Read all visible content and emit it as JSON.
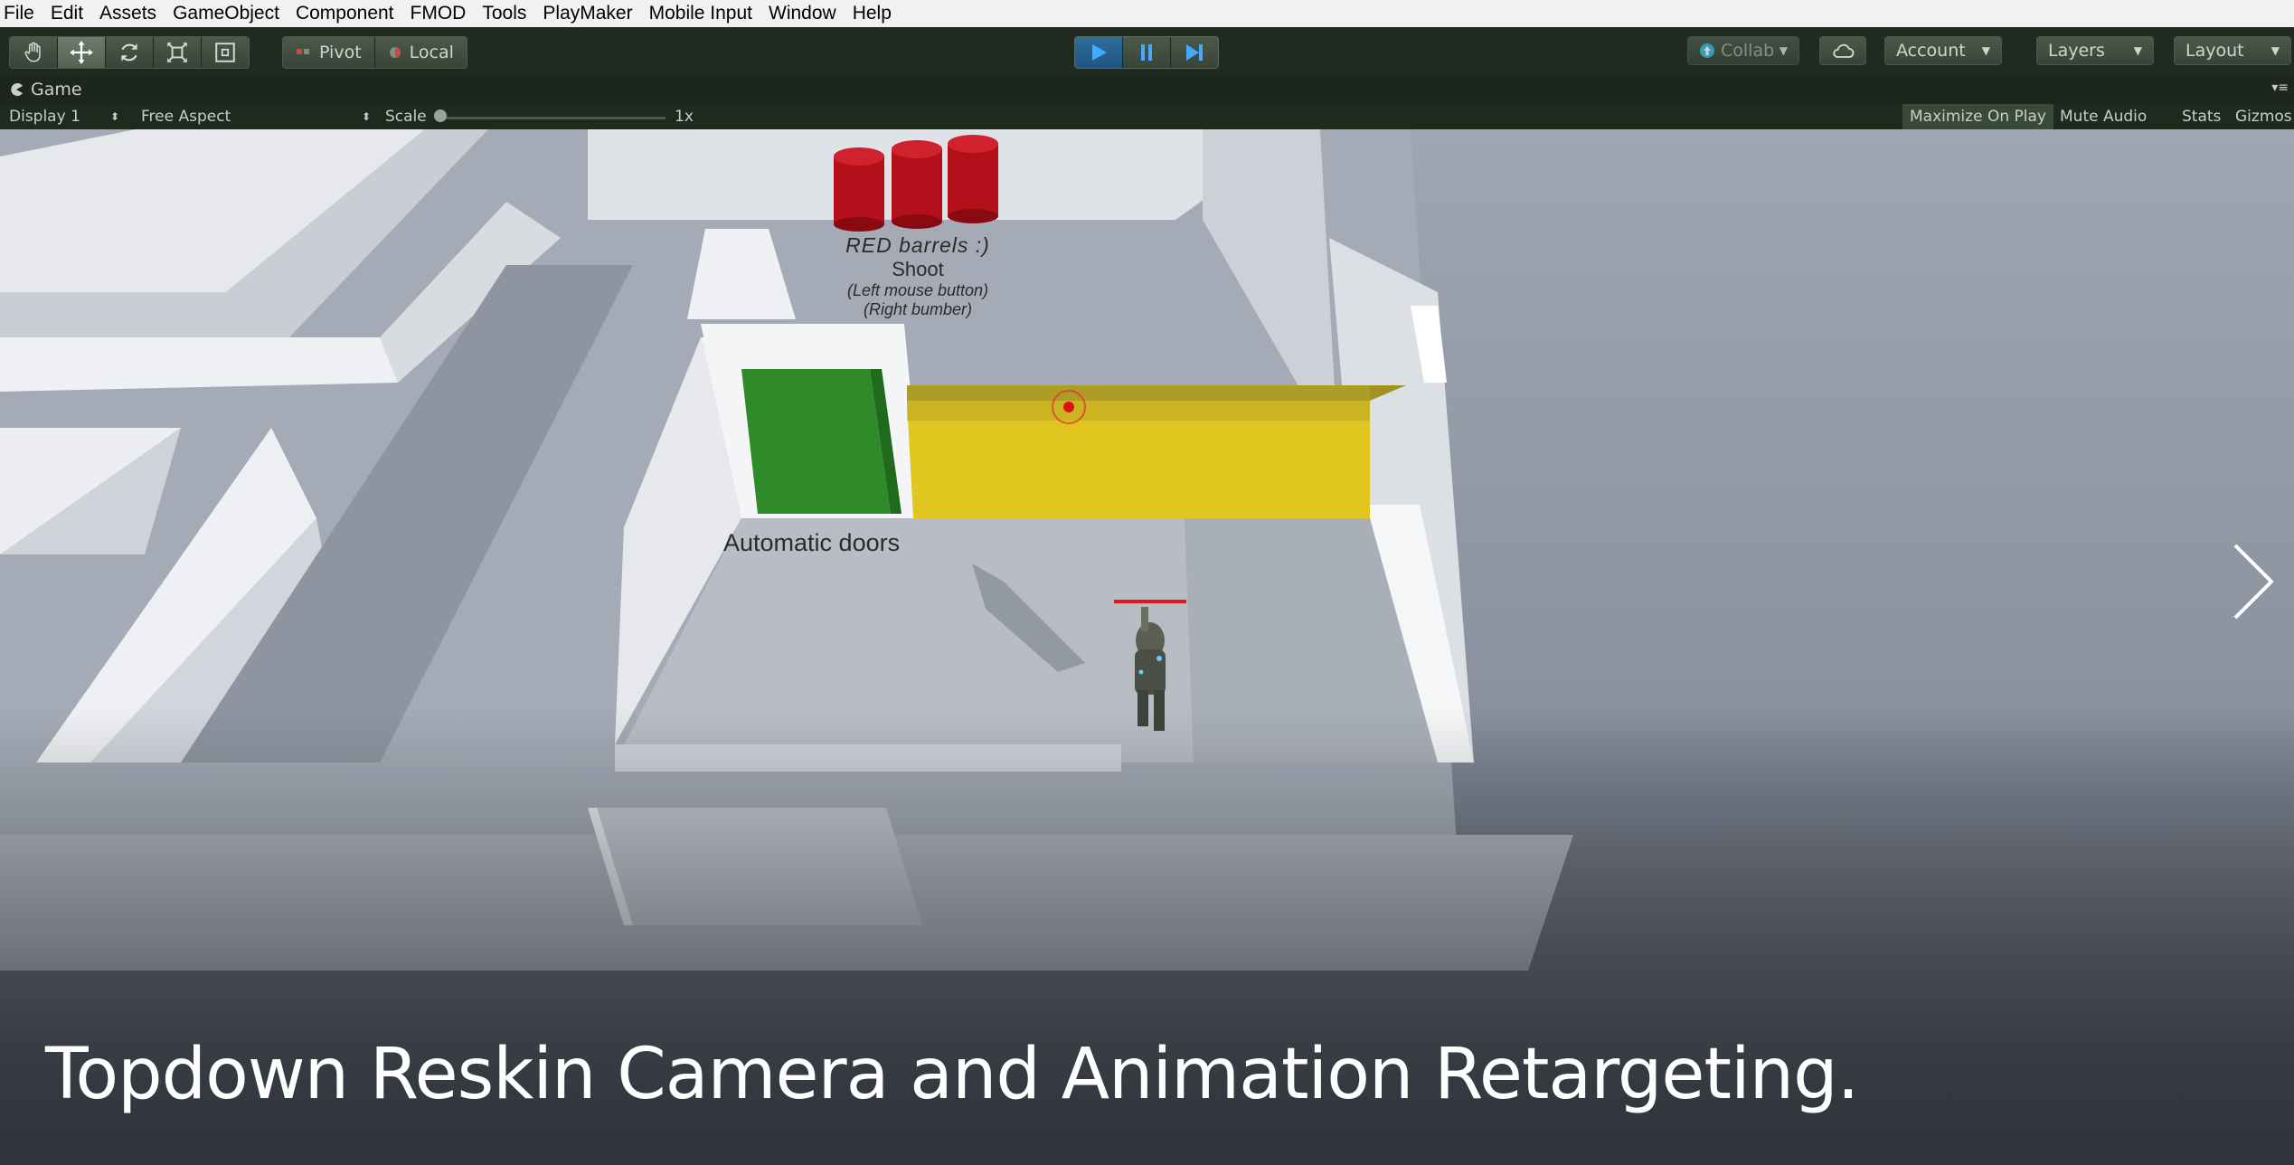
{
  "menu": [
    "File",
    "Edit",
    "Assets",
    "GameObject",
    "Component",
    "FMOD",
    "Tools",
    "PlayMaker",
    "Mobile Input",
    "Window",
    "Help"
  ],
  "toolbar": {
    "tools": [
      "hand-icon",
      "move-icon",
      "rotate-icon",
      "scale-icon",
      "rect-icon"
    ],
    "active_tool": "move-icon",
    "pivot_label": "Pivot",
    "local_label": "Local",
    "collab_label": "Collab",
    "account_label": "Account",
    "layers_label": "Layers",
    "layout_label": "Layout"
  },
  "game": {
    "tab_label": "Game",
    "display_label": "Display 1",
    "aspect_label": "Free Aspect",
    "scale_label": "Scale",
    "scale_value": "1x",
    "maximize_label": "Maximize On Play",
    "mute_label": "Mute Audio",
    "stats_label": "Stats",
    "gizmos_label": "Gizmos"
  },
  "scene": {
    "barrels_line1": "RED barrels :)",
    "barrels_line2": "Shoot",
    "barrels_line3": "(Left mouse button)",
    "barrels_line4": "(Right bumber)",
    "doors_label": "Automatic doors"
  },
  "caption": "Topdown Reskin Camera and Animation Retargeting.",
  "colors": {
    "toolbar_bg": "#202a20",
    "play_active": "#2e6e9c",
    "door_green": "#2f8a2a",
    "door_yellow": "#e0c61e",
    "barrel_red": "#b3101c"
  }
}
